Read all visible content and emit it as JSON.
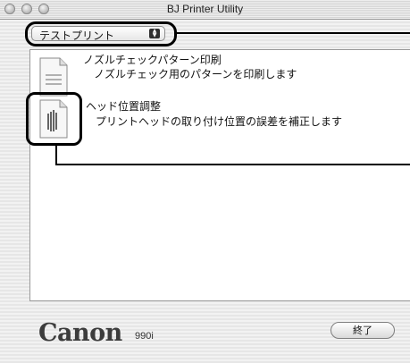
{
  "window": {
    "title": "BJ Printer Utility"
  },
  "popup": {
    "selected": "テストプリント"
  },
  "items": [
    {
      "title": "ノズルチェックパターン印刷",
      "desc": "ノズルチェック用のパターンを印刷します",
      "icon": "document-icon"
    },
    {
      "title": "ヘッド位置調整",
      "desc": "プリントヘッドの取り付け位置の誤差を補正します",
      "icon": "head-alignment-icon"
    }
  ],
  "footer": {
    "brand": "Canon",
    "model": "990i",
    "quit_label": "終了"
  },
  "colors": {
    "callout": "#000000",
    "background_stripe": "#e6e6e6"
  }
}
